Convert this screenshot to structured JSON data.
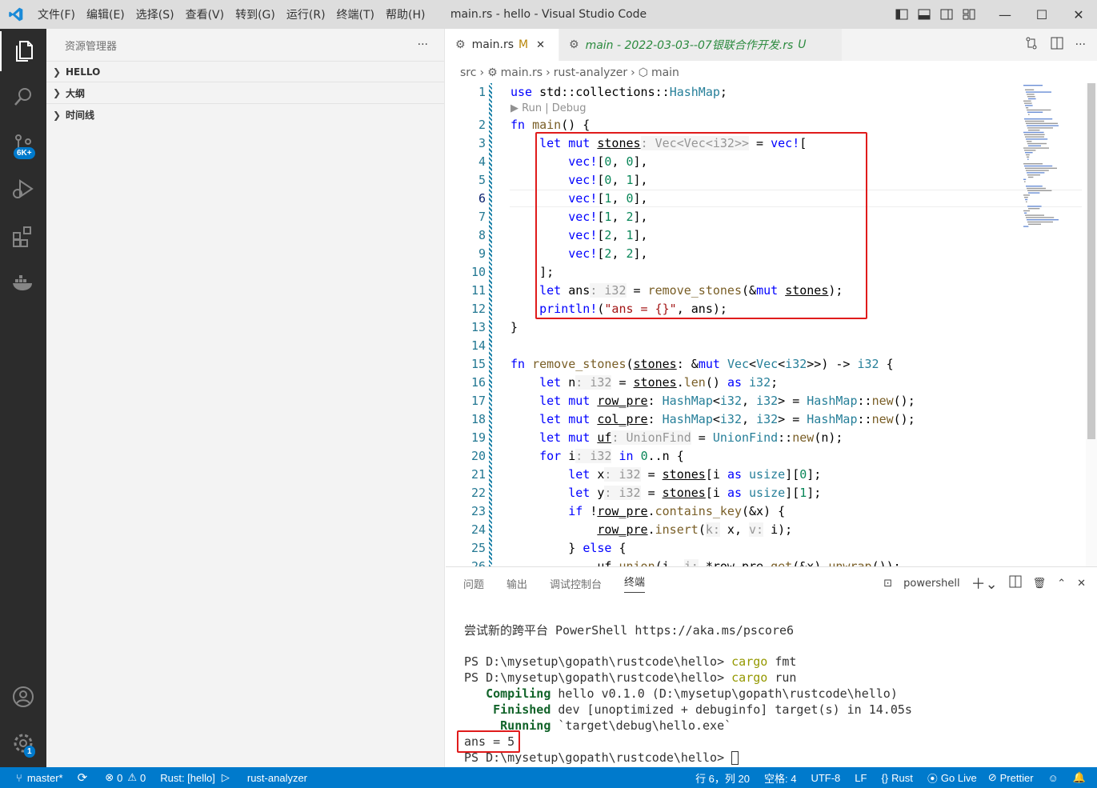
{
  "window": {
    "title": "main.rs - hello - Visual Studio Code"
  },
  "menu": [
    "文件(F)",
    "编辑(E)",
    "选择(S)",
    "查看(V)",
    "转到(G)",
    "运行(R)",
    "终端(T)",
    "帮助(H)"
  ],
  "activity": {
    "source_control_badge": "6K+",
    "settings_badge": "1"
  },
  "sidebar": {
    "title": "资源管理器",
    "more": "···",
    "sections": [
      "HELLO",
      "大纲",
      "时间线"
    ]
  },
  "tabs": [
    {
      "label": "main.rs",
      "status": "M",
      "close": "✕"
    },
    {
      "label": "main - 2022-03-03--07银联合作开发.rs",
      "status": "U"
    }
  ],
  "breadcrumb": [
    "src",
    "main.rs",
    "rust-analyzer",
    "main"
  ],
  "editor": {
    "code_lens": "▶ Run | Debug",
    "line_numbers": [
      "1",
      "2",
      "3",
      "4",
      "5",
      "6",
      "7",
      "8",
      "9",
      "10",
      "11",
      "12",
      "13",
      "14",
      "15",
      "16",
      "17",
      "18",
      "19",
      "20",
      "21",
      "22",
      "23",
      "24",
      "25",
      "26"
    ],
    "current_line": "6"
  },
  "panel": {
    "tabs": [
      "问题",
      "输出",
      "调试控制台",
      "终端"
    ],
    "active_tab": "终端",
    "shell": "powershell",
    "terminal_lines": [
      "尝试新的跨平台 PowerShell https://aka.ms/pscore6",
      "",
      "PS D:\\mysetup\\gopath\\rustcode\\hello> cargo fmt",
      "PS D:\\mysetup\\gopath\\rustcode\\hello> cargo run",
      "   Compiling hello v0.1.0 (D:\\mysetup\\gopath\\rustcode\\hello)",
      "    Finished dev [unoptimized + debuginfo] target(s) in 14.05s",
      "     Running `target\\debug\\hello.exe`",
      "ans = 5",
      "PS D:\\mysetup\\gopath\\rustcode\\hello> "
    ]
  },
  "status": {
    "branch": "master*",
    "errors": "0",
    "warnings": "0",
    "rust_target": "Rust: [hello]",
    "analyzer": "rust-analyzer",
    "position": "行 6，列 20",
    "spaces": "空格: 4",
    "encoding": "UTF-8",
    "eol": "LF",
    "language": "Rust",
    "golive": "Go Live",
    "prettier": "Prettier"
  },
  "colors": {
    "accent": "#007acc",
    "highlight_box": "#e01b1b",
    "activity_bar": "#2c2c2c"
  }
}
